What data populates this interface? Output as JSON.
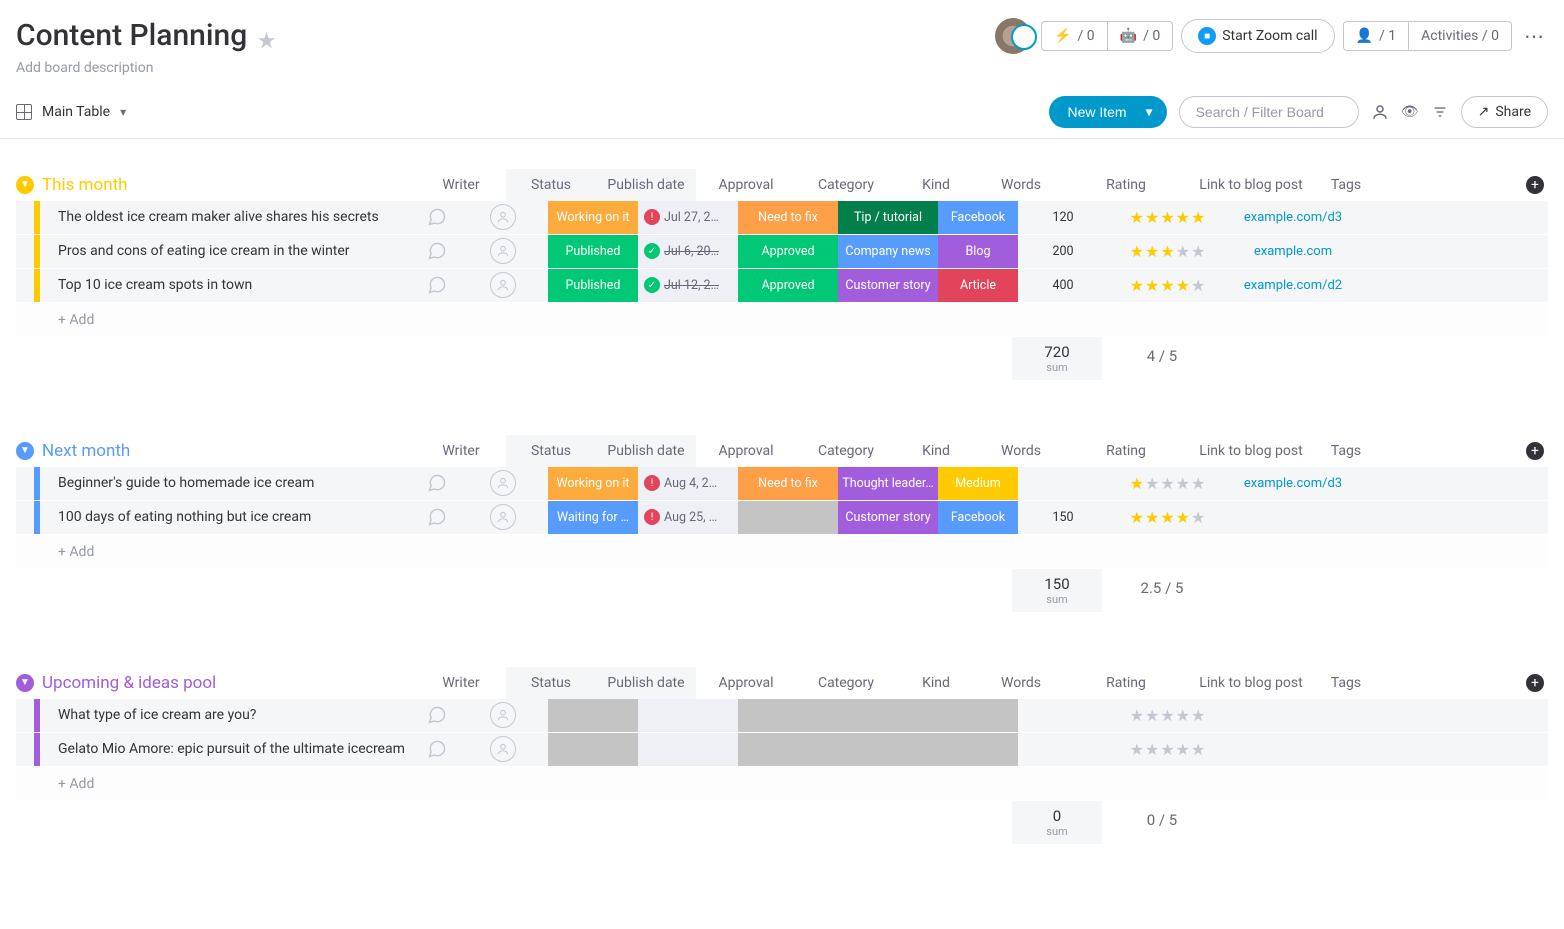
{
  "board": {
    "title": "Content Planning",
    "description_placeholder": "Add board description",
    "view_name": "Main Table"
  },
  "header_buttons": {
    "counter1": "/ 0",
    "counter2": "/ 0",
    "zoom_label": "Start Zoom call",
    "members": "/ 1",
    "activities": "Activities / 0"
  },
  "toolbar": {
    "new_item": "New Item",
    "search_placeholder": "Search / Filter Board",
    "share": "Share"
  },
  "columns": {
    "writer": "Writer",
    "status": "Status",
    "publish_date": "Publish date",
    "approval": "Approval",
    "category": "Category",
    "kind": "Kind",
    "words": "Words",
    "rating": "Rating",
    "link": "Link to blog post",
    "tags": "Tags"
  },
  "add_row": "+ Add",
  "groups": [
    {
      "name": "This month",
      "color": "#ffcb00",
      "rows": [
        {
          "name": "The oldest ice cream maker alive shares his secrets",
          "status": {
            "text": "Working on it",
            "bg": "#fdab3d"
          },
          "date": {
            "text": "Jul 27, 2…",
            "dot": "red",
            "strike": false
          },
          "approval": {
            "text": "Need to fix",
            "bg": "#ff9f47"
          },
          "category": {
            "text": "Tip / tutorial",
            "bg": "#037f4c"
          },
          "kind": {
            "text": "Facebook",
            "bg": "#579bfc"
          },
          "words": "120",
          "rating": 5,
          "link": "example.com/d3"
        },
        {
          "name": "Pros and cons of eating ice cream in the winter",
          "status": {
            "text": "Published",
            "bg": "#00c875"
          },
          "date": {
            "text": "Jul 6, 20…",
            "dot": "green",
            "strike": true
          },
          "approval": {
            "text": "Approved",
            "bg": "#00c875"
          },
          "category": {
            "text": "Company news",
            "bg": "#579bfc"
          },
          "kind": {
            "text": "Blog",
            "bg": "#a25ddc"
          },
          "words": "200",
          "rating": 3,
          "link": "example.com"
        },
        {
          "name": "Top 10 ice cream spots in town",
          "status": {
            "text": "Published",
            "bg": "#00c875"
          },
          "date": {
            "text": "Jul 12, 2…",
            "dot": "green",
            "strike": true
          },
          "approval": {
            "text": "Approved",
            "bg": "#00c875"
          },
          "category": {
            "text": "Customer story",
            "bg": "#a25ddc"
          },
          "kind": {
            "text": "Article",
            "bg": "#e2445c"
          },
          "words": "400",
          "rating": 4,
          "link": "example.com/d2"
        }
      ],
      "sum": "720",
      "sum_label": "sum",
      "avg_rating": "4 / 5"
    },
    {
      "name": "Next month",
      "color": "#579bfc",
      "rows": [
        {
          "name": "Beginner's guide to homemade ice cream",
          "status": {
            "text": "Working on it",
            "bg": "#fdab3d"
          },
          "date": {
            "text": "Aug 4, 2…",
            "dot": "red",
            "strike": false
          },
          "approval": {
            "text": "Need to fix",
            "bg": "#ff9f47"
          },
          "category": {
            "text": "Thought leader…",
            "bg": "#a25ddc"
          },
          "kind": {
            "text": "Medium",
            "bg": "#ffcb00"
          },
          "words": "",
          "rating": 1,
          "link": "example.com/d3"
        },
        {
          "name": "100 days of eating nothing but ice cream",
          "status": {
            "text": "Waiting for …",
            "bg": "#579bfc"
          },
          "date": {
            "text": "Aug 25, …",
            "dot": "red",
            "strike": false
          },
          "approval": {
            "text": "",
            "bg": "#c4c4c4"
          },
          "category": {
            "text": "Customer story",
            "bg": "#a25ddc"
          },
          "kind": {
            "text": "Facebook",
            "bg": "#579bfc"
          },
          "words": "150",
          "rating": 4,
          "link": ""
        }
      ],
      "sum": "150",
      "sum_label": "sum",
      "avg_rating": "2.5 / 5"
    },
    {
      "name": "Upcoming & ideas pool",
      "color": "#a25ddc",
      "rows": [
        {
          "name": "What type of ice cream are you?",
          "status": {
            "text": "",
            "bg": "#c4c4c4"
          },
          "date": {
            "text": "",
            "dot": "",
            "strike": false
          },
          "approval": {
            "text": "",
            "bg": "#c4c4c4"
          },
          "category": {
            "text": "",
            "bg": "#c4c4c4"
          },
          "kind": {
            "text": "",
            "bg": "#c4c4c4"
          },
          "words": "",
          "rating": 0,
          "link": ""
        },
        {
          "name": "Gelato Mio Amore: epic pursuit of the ultimate icecream",
          "status": {
            "text": "",
            "bg": "#c4c4c4"
          },
          "date": {
            "text": "",
            "dot": "",
            "strike": false
          },
          "approval": {
            "text": "",
            "bg": "#c4c4c4"
          },
          "category": {
            "text": "",
            "bg": "#c4c4c4"
          },
          "kind": {
            "text": "",
            "bg": "#c4c4c4"
          },
          "words": "",
          "rating": 0,
          "link": ""
        }
      ],
      "sum": "0",
      "sum_label": "sum",
      "avg_rating": "0 / 5"
    }
  ]
}
